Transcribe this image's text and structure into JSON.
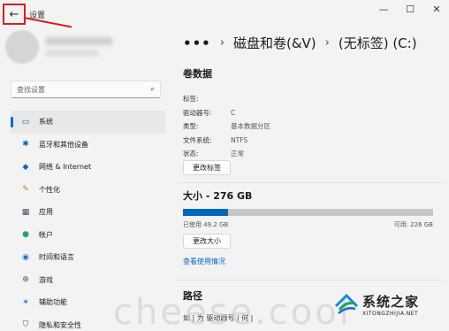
{
  "window": {
    "title": "设置",
    "controls": {
      "minimize": "—",
      "maximize": "☐",
      "close": "✕"
    }
  },
  "search": {
    "placeholder": "查找设置"
  },
  "sidebar": {
    "items": [
      {
        "label": "系统",
        "icon": "monitor-icon",
        "glyph": "▭",
        "color": "#0067c0",
        "active": true
      },
      {
        "label": "蓝牙和其他设备",
        "icon": "bluetooth-icon",
        "glyph": "✱",
        "color": "#0067c0",
        "active": false
      },
      {
        "label": "网络 & Internet",
        "icon": "wifi-icon",
        "glyph": "◆",
        "color": "#0067c0",
        "active": false
      },
      {
        "label": "个性化",
        "icon": "brush-icon",
        "glyph": "✎",
        "color": "#d0781a",
        "active": false
      },
      {
        "label": "应用",
        "icon": "apps-icon",
        "glyph": "▦",
        "color": "#3a4a5a",
        "active": false
      },
      {
        "label": "帐户",
        "icon": "person-icon",
        "glyph": "●",
        "color": "#2aa06a",
        "active": false
      },
      {
        "label": "时间和语言",
        "icon": "globe-clock-icon",
        "glyph": "◉",
        "color": "#1a70c8",
        "active": false
      },
      {
        "label": "游戏",
        "icon": "gamepad-icon",
        "glyph": "⊕",
        "color": "#555555",
        "active": false
      },
      {
        "label": "辅助功能",
        "icon": "accessibility-icon",
        "glyph": "✶",
        "color": "#1a70c8",
        "active": false
      },
      {
        "label": "隐私和安全性",
        "icon": "shield-icon",
        "glyph": "⛉",
        "color": "#555555",
        "active": false
      }
    ]
  },
  "breadcrumb": {
    "dots": "•••",
    "sep": "›",
    "parent": "磁盘和卷(&V)",
    "current": "(无标签) (C:)"
  },
  "volume": {
    "title": "卷数据",
    "props": [
      {
        "label": "标签:",
        "value": ""
      },
      {
        "label": "驱动器号:",
        "value": "C"
      },
      {
        "label": "类型:",
        "value": "基本数据分区"
      },
      {
        "label": "文件系统:",
        "value": "NTFS"
      },
      {
        "label": "状态:",
        "value": "正常"
      }
    ],
    "change_label_button": "更改标签"
  },
  "size": {
    "title": "大小 - 276 GB",
    "used_fraction": 0.18,
    "used_text": "已使用 49.2 GB",
    "free_text": "可用: 226 GB",
    "change_size_button": "更改大小",
    "usage_link": "查看使用情况"
  },
  "path": {
    "title": "路径",
    "partial_text": "如 | 为 驱动器号 | 何 |"
  },
  "overlay": {
    "watermark": "cheese.cool",
    "logo_cn": "系统之家",
    "logo_en": "XITONGZHIJIA.NET"
  }
}
